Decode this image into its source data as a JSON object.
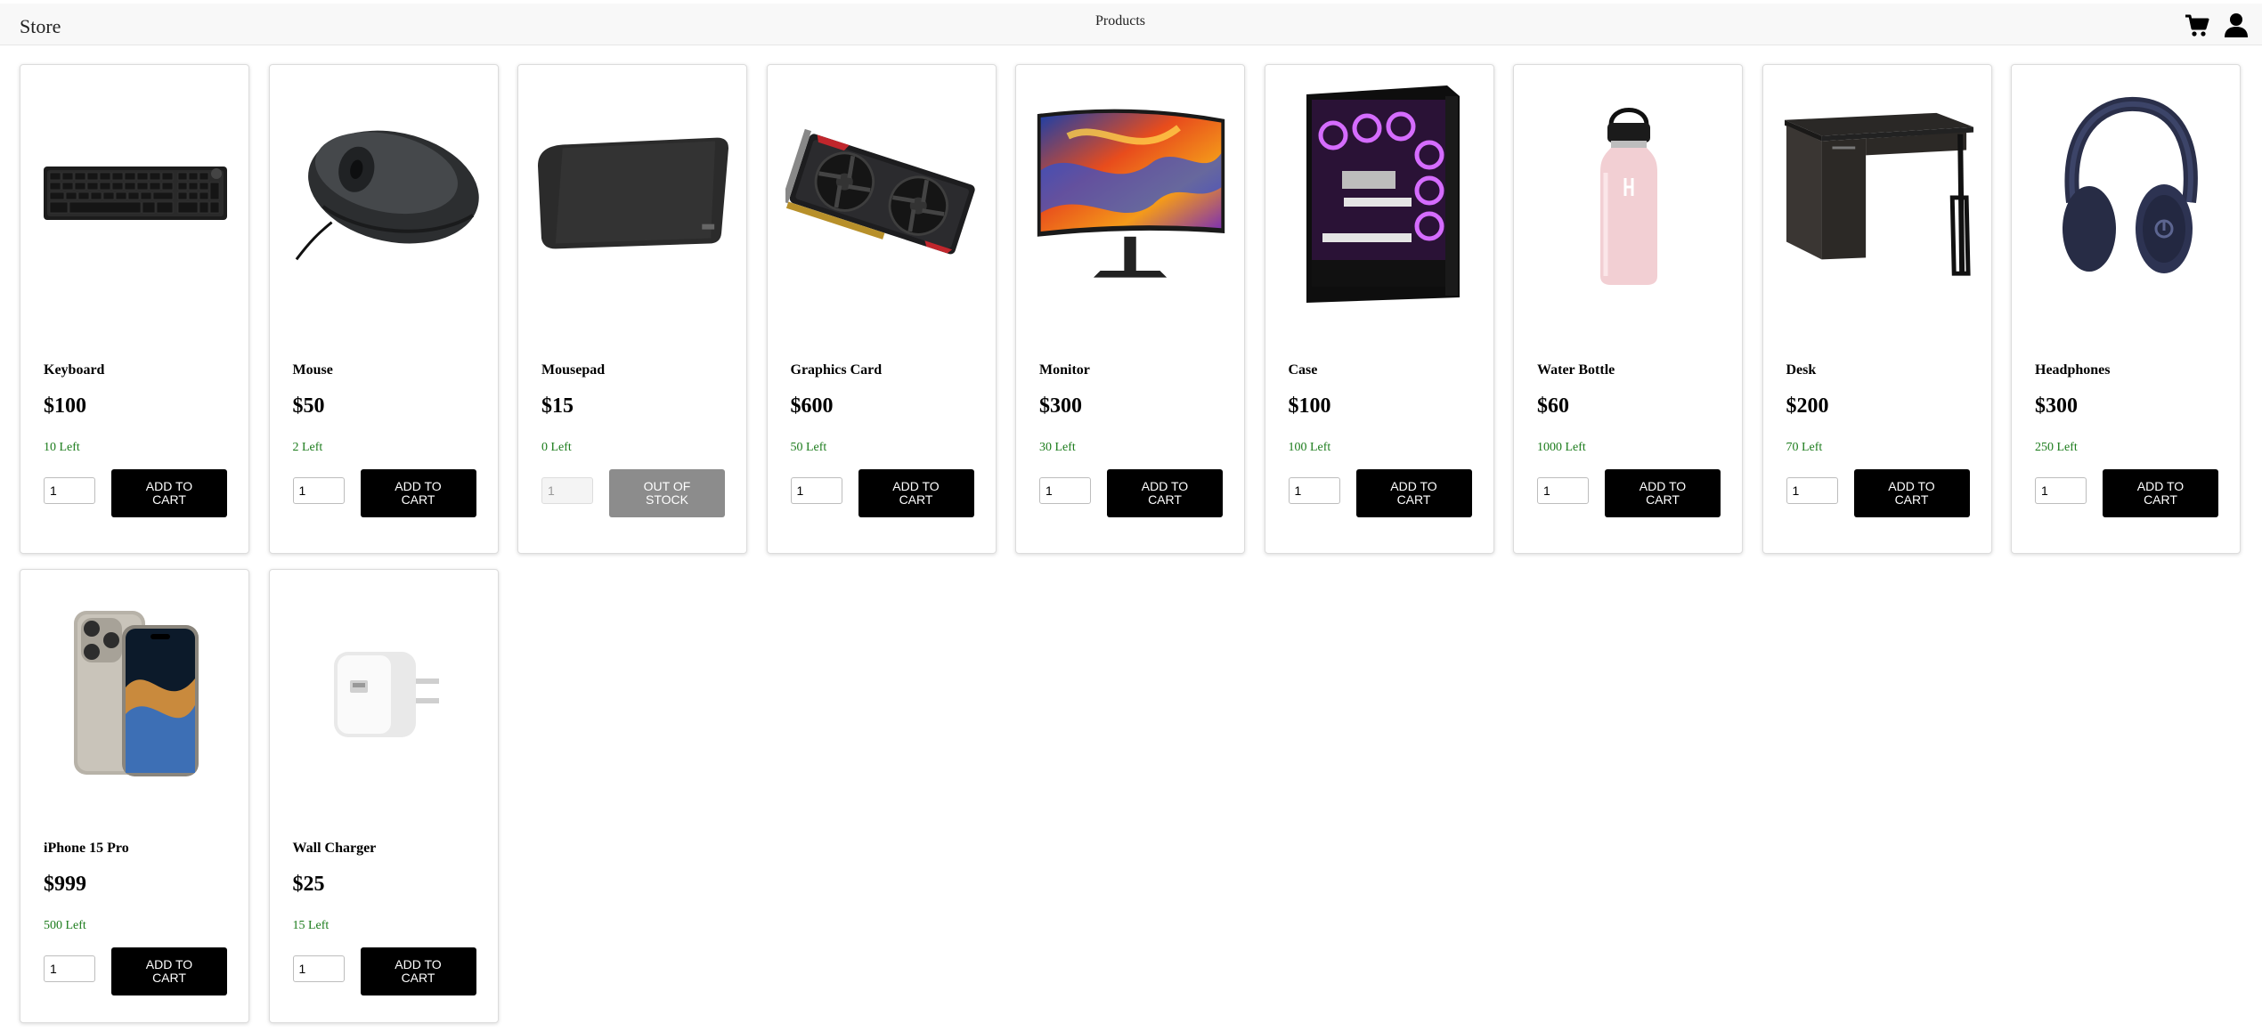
{
  "header": {
    "brand": "Store",
    "nav_label": "Products",
    "cart_icon": "cart-icon",
    "user_icon": "user-icon"
  },
  "products": [
    {
      "name": "Keyboard",
      "price": "$100",
      "stock": "10 Left",
      "qty": "1",
      "button": "ADD TO CART",
      "icon": "keyboard-image"
    },
    {
      "name": "Mouse",
      "price": "$50",
      "stock": "2 Left",
      "qty": "1",
      "button": "ADD TO CART",
      "icon": "mouse-image"
    },
    {
      "name": "Mousepad",
      "price": "$15",
      "stock": "0 Left",
      "qty": "1",
      "button": "OUT OF STOCK",
      "icon": "mousepad-image"
    },
    {
      "name": "Graphics Card",
      "price": "$600",
      "stock": "50 Left",
      "qty": "1",
      "button": "ADD TO CART",
      "icon": "graphics-card-image"
    },
    {
      "name": "Monitor",
      "price": "$300",
      "stock": "30 Left",
      "qty": "1",
      "button": "ADD TO CART",
      "icon": "monitor-image"
    },
    {
      "name": "Case",
      "price": "$100",
      "stock": "100 Left",
      "qty": "1",
      "button": "ADD TO CART",
      "icon": "pc-case-image"
    },
    {
      "name": "Water Bottle",
      "price": "$60",
      "stock": "1000 Left",
      "qty": "1",
      "button": "ADD TO CART",
      "icon": "water-bottle-image"
    },
    {
      "name": "Desk",
      "price": "$200",
      "stock": "70 Left",
      "qty": "1",
      "button": "ADD TO CART",
      "icon": "desk-image"
    },
    {
      "name": "Headphones",
      "price": "$300",
      "stock": "250 Left",
      "qty": "1",
      "button": "ADD TO CART",
      "icon": "headphones-image"
    },
    {
      "name": "iPhone 15 Pro",
      "price": "$999",
      "stock": "500 Left",
      "qty": "1",
      "button": "ADD TO CART",
      "icon": "iphone-image"
    },
    {
      "name": "Wall Charger",
      "price": "$25",
      "stock": "15 Left",
      "qty": "1",
      "button": "ADD TO CART",
      "icon": "wall-charger-image"
    }
  ],
  "colors": {
    "accent": "#000000",
    "in_stock_text": "#1c7c1c",
    "out_of_stock_button": "#8c8c8c",
    "header_bg": "#f8f8f8"
  }
}
